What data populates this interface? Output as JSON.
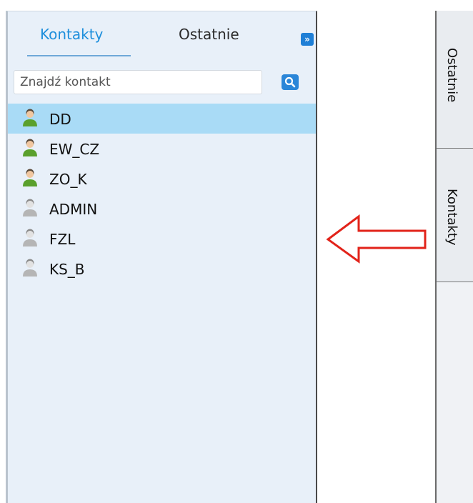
{
  "contacts_panel": {
    "tabs": [
      {
        "label": "Kontakty",
        "active": true
      },
      {
        "label": "Ostatnie",
        "active": false
      }
    ],
    "expand_icon": "double-chevron-right-icon",
    "search": {
      "placeholder": "Znajdź kontakt",
      "value": ""
    },
    "search_icon": "search-icon",
    "contacts": [
      {
        "name": "DD",
        "status": "online",
        "selected": true
      },
      {
        "name": "EW_CZ",
        "status": "online",
        "selected": false
      },
      {
        "name": "ZO_K",
        "status": "online",
        "selected": false
      },
      {
        "name": "ADMIN",
        "status": "offline",
        "selected": false
      },
      {
        "name": "FZL",
        "status": "offline",
        "selected": false
      },
      {
        "name": "KS_B",
        "status": "offline",
        "selected": false
      }
    ]
  },
  "right_sidebar": {
    "tabs": [
      {
        "label": "Ostatnie"
      },
      {
        "label": "Kontakty"
      }
    ]
  },
  "colors": {
    "online": "#5aa02c",
    "offline": "#b5b5b5",
    "accent": "#1e8fdc",
    "selected_row": "#a9dbf6",
    "arrow": "#e2231a"
  }
}
